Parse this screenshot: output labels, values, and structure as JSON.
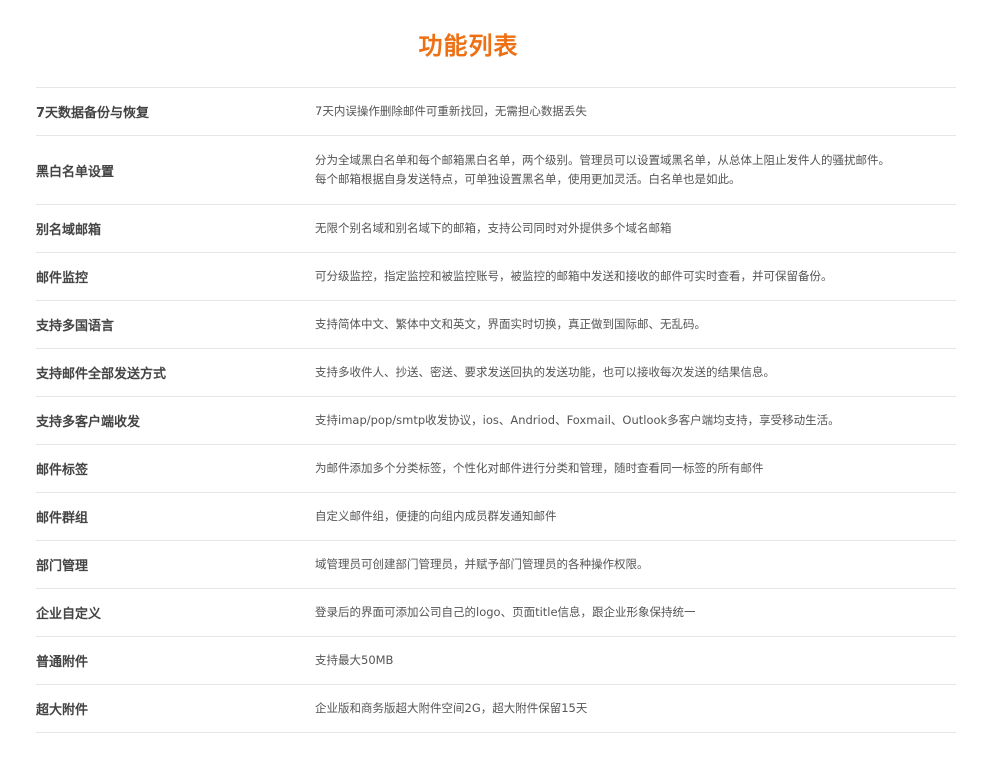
{
  "page": {
    "title": "功能列表"
  },
  "features": [
    {
      "name": "7天数据备份与恢复",
      "desc": [
        "7天内误操作删除邮件可重新找回，无需担心数据丢失"
      ]
    },
    {
      "name": "黑白名单设置",
      "desc": [
        "分为全域黑白名单和每个邮箱黑白名单，两个级别。管理员可以设置域黑名单，从总体上阻止发件人的骚扰邮件。",
        "每个邮箱根据自身发送特点，可单独设置黑名单，使用更加灵活。白名单也是如此。"
      ]
    },
    {
      "name": "别名域邮箱",
      "desc": [
        "无限个别名域和别名域下的邮箱，支持公司同时对外提供多个域名邮箱"
      ]
    },
    {
      "name": "邮件监控",
      "desc": [
        "可分级监控，指定监控和被监控账号，被监控的邮箱中发送和接收的邮件可实时查看，并可保留备份。"
      ]
    },
    {
      "name": "支持多国语言",
      "desc": [
        "支持简体中文、繁体中文和英文，界面实时切换，真正做到国际邮、无乱码。"
      ]
    },
    {
      "name": "支持邮件全部发送方式",
      "desc": [
        "支持多收件人、抄送、密送、要求发送回执的发送功能，也可以接收每次发送的结果信息。"
      ]
    },
    {
      "name": "支持多客户端收发",
      "desc": [
        "支持imap/pop/smtp收发协议，ios、Andriod、Foxmail、Outlook多客户端均支持，享受移动生活。"
      ]
    },
    {
      "name": "邮件标签",
      "desc": [
        "为邮件添加多个分类标签，个性化对邮件进行分类和管理，随时查看同一标签的所有邮件"
      ]
    },
    {
      "name": "邮件群组",
      "desc": [
        "自定义邮件组，便捷的向组内成员群发通知邮件"
      ]
    },
    {
      "name": "部门管理",
      "desc": [
        "域管理员可创建部门管理员，并赋予部门管理员的各种操作权限。"
      ]
    },
    {
      "name": "企业自定义",
      "desc": [
        "登录后的界面可添加公司自己的logo、页面title信息，跟企业形象保持统一"
      ]
    },
    {
      "name": "普通附件",
      "desc": [
        "支持最大50MB"
      ]
    },
    {
      "name": "超大附件",
      "desc": [
        "企业版和商务版超大附件空间2G，超大附件保留15天"
      ]
    }
  ]
}
